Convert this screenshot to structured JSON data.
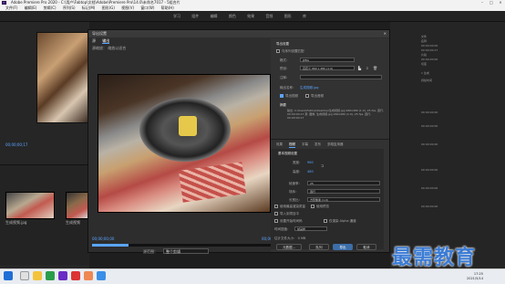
{
  "window": {
    "title": "Adobe Premiere Pro 2020 - C:\\用户\\Fabtop\\文档\\Adobe\\Premiere Pro\\14.0\\未命名7017 - 5组合片"
  },
  "menu": [
    "文件(F)",
    "编辑(E)",
    "剪辑(C)",
    "序列(S)",
    "标记(M)",
    "图形(G)",
    "视图(V)",
    "窗口(W)",
    "帮助(H)"
  ],
  "workspace": [
    "学习",
    "组件",
    "编辑",
    "颜色",
    "效果",
    "音频",
    "图形",
    "库"
  ],
  "left": {
    "timecode": "00;00;00;17",
    "project_thumbs": [
      "生成视频.jpg",
      "生成视频"
    ]
  },
  "right_panel": {
    "lines": [
      "文件",
      "名称",
      "00:00:00:00",
      "00:00:00:17",
      "片段",
      "00:00:00:00",
      "切变",
      "1 生成",
      "持续时间",
      "00:00:00:00",
      "00:00:00:00",
      "00:00:00:00",
      "00:00:00:00",
      "00:00:00:00",
      "00:00:00:00"
    ]
  },
  "dialog": {
    "title": "导出设置",
    "tabs": [
      "源",
      "输出"
    ],
    "source_scaling": "源缩放：  缩放以适合",
    "timecode_in": "00;00;00;00",
    "timecode_out": "00;00;00;17",
    "range_label": "源范围：",
    "range_value": "整个剪辑"
  },
  "settings": {
    "section_export": "导出设置",
    "match_sequence": "与序列设置匹配",
    "format_label": "格式：",
    "format_value": "JPEG",
    "preset_label": "预设：",
    "preset_value": "自定义 960 x 480 (1.0)",
    "comments_label": "注释：",
    "output_name_label": "输出名称：",
    "output_name_value": "生成视频.jpg",
    "export_video": "导出视频",
    "export_audio": "导出音频",
    "summary_label": "摘要",
    "summary_text": "输出: C:\\Users\\Fabtop\\Desktop\\生成视频.jpg  960x480 (1.0), 25 fps, 逐行, 00:00:00:17  源: 图像, 生成视频.jpg  960x480 (1.0), 25 fps, 逐行, 00:00:00:17",
    "sub_tabs": [
      "效果",
      "视频",
      "字幕",
      "发布",
      "多路复用器"
    ],
    "basic_video": "基本视频设置",
    "width_label": "宽度：",
    "width_value": "960",
    "height_label": "高度：",
    "height_value": "480",
    "framerate_label": "帧速率：",
    "framerate_value": "25",
    "field_label": "场序：",
    "field_value": "逐行",
    "aspect_label": "长宽比：",
    "aspect_value": "方形像素 (1.0)",
    "use_max_render": "使用最高渲染质量",
    "use_previews": "使用预览",
    "import_project": "导入到项目中",
    "set_start_tc": "设置开始时间码",
    "render_alpha": "仅渲染 Alpha 通道",
    "time_interp_label": "时间插值：",
    "time_interp_value": "帧采样",
    "est_size": "估计文件大小：  0 MB",
    "btn_metadata": "元数据...",
    "btn_queue": "队列",
    "btn_export": "导出",
    "btn_cancel": "取消"
  },
  "taskbar": {
    "time": "17:25",
    "date": "2021/5/14"
  },
  "watermark": "最需教育"
}
